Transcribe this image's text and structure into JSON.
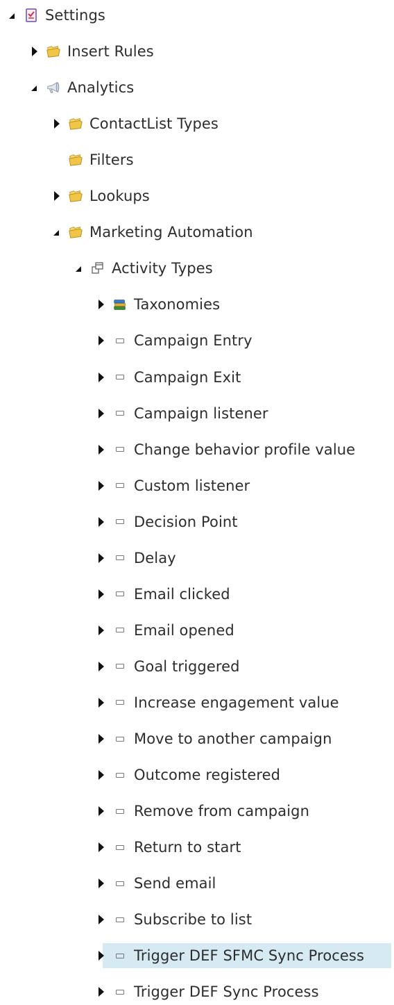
{
  "tree": {
    "nodes": [
      {
        "label": "Settings",
        "level": 0,
        "expander": "open",
        "icon": "settings-checklist-icon"
      },
      {
        "label": "Insert Rules",
        "level": 1,
        "expander": "closed",
        "icon": "folder-icon"
      },
      {
        "label": "Analytics",
        "level": 1,
        "expander": "open",
        "icon": "analytics-megaphone-icon"
      },
      {
        "label": "ContactList Types",
        "level": 2,
        "expander": "closed",
        "icon": "folder-icon"
      },
      {
        "label": "Filters",
        "level": 2,
        "expander": "none",
        "icon": "folder-icon"
      },
      {
        "label": "Lookups",
        "level": 2,
        "expander": "closed",
        "icon": "folder-icon"
      },
      {
        "label": "Marketing Automation",
        "level": 2,
        "expander": "open",
        "icon": "folder-icon"
      },
      {
        "label": "Activity Types",
        "level": 3,
        "expander": "open",
        "icon": "activity-types-icon"
      },
      {
        "label": "Taxonomies",
        "level": 4,
        "expander": "closed",
        "icon": "taxonomies-books-icon"
      },
      {
        "label": "Campaign Entry",
        "level": 4,
        "expander": "closed",
        "icon": "item-rectangle-icon"
      },
      {
        "label": "Campaign Exit",
        "level": 4,
        "expander": "closed",
        "icon": "item-rectangle-icon"
      },
      {
        "label": "Campaign listener",
        "level": 4,
        "expander": "closed",
        "icon": "item-rectangle-icon"
      },
      {
        "label": "Change behavior profile value",
        "level": 4,
        "expander": "closed",
        "icon": "item-rectangle-icon"
      },
      {
        "label": "Custom listener",
        "level": 4,
        "expander": "closed",
        "icon": "item-rectangle-icon"
      },
      {
        "label": "Decision Point",
        "level": 4,
        "expander": "closed",
        "icon": "item-rectangle-icon"
      },
      {
        "label": "Delay",
        "level": 4,
        "expander": "closed",
        "icon": "item-rectangle-icon"
      },
      {
        "label": "Email clicked",
        "level": 4,
        "expander": "closed",
        "icon": "item-rectangle-icon"
      },
      {
        "label": "Email opened",
        "level": 4,
        "expander": "closed",
        "icon": "item-rectangle-icon"
      },
      {
        "label": "Goal triggered",
        "level": 4,
        "expander": "closed",
        "icon": "item-rectangle-icon"
      },
      {
        "label": "Increase engagement value",
        "level": 4,
        "expander": "closed",
        "icon": "item-rectangle-icon"
      },
      {
        "label": "Move to another campaign",
        "level": 4,
        "expander": "closed",
        "icon": "item-rectangle-icon"
      },
      {
        "label": "Outcome registered",
        "level": 4,
        "expander": "closed",
        "icon": "item-rectangle-icon"
      },
      {
        "label": "Remove from campaign",
        "level": 4,
        "expander": "closed",
        "icon": "item-rectangle-icon"
      },
      {
        "label": "Return to start",
        "level": 4,
        "expander": "closed",
        "icon": "item-rectangle-icon"
      },
      {
        "label": "Send email",
        "level": 4,
        "expander": "closed",
        "icon": "item-rectangle-icon"
      },
      {
        "label": "Subscribe to list",
        "level": 4,
        "expander": "closed",
        "icon": "item-rectangle-icon"
      },
      {
        "label": "Trigger DEF SFMC Sync Process",
        "level": 4,
        "expander": "closed",
        "icon": "item-rectangle-icon",
        "selected": true
      },
      {
        "label": "Trigger DEF Sync Process",
        "level": 4,
        "expander": "closed",
        "icon": "item-rectangle-icon"
      }
    ]
  },
  "colors": {
    "selection_background": "#d5eaf3",
    "folder_yellow": "#f0c64a",
    "text": "#2d2d2d"
  }
}
